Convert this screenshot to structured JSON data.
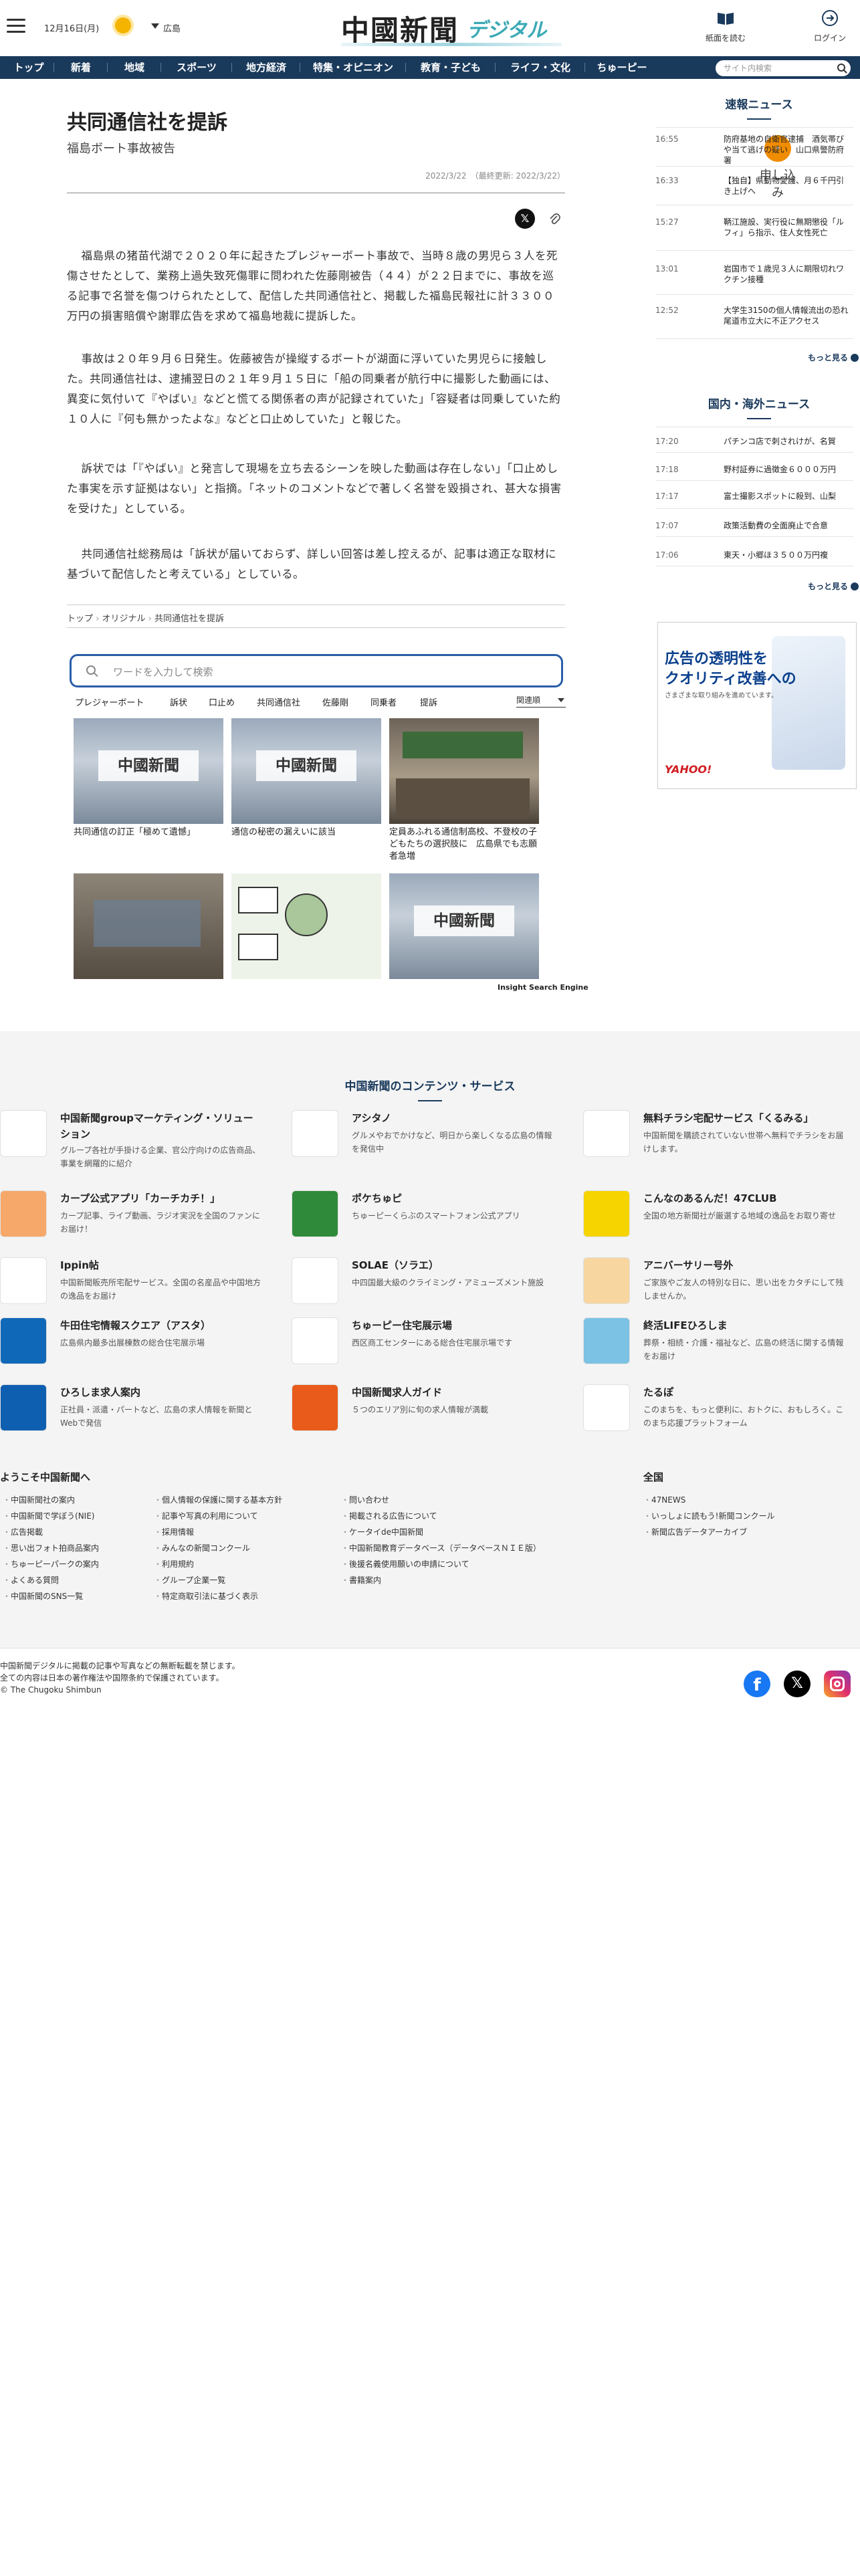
{
  "header": {
    "date": "12月16日(月)",
    "area": "広島",
    "logo_main": "中國新聞",
    "logo_sub": "デジタル",
    "icons": [
      {
        "label": "紙面を読む"
      },
      {
        "label": "申し込み"
      },
      {
        "label": "ログイン"
      }
    ]
  },
  "nav": {
    "items": [
      "トップ",
      "新着",
      "地域",
      "スポーツ",
      "地方経済",
      "特集・オピニオン",
      "教育・子ども",
      "ライフ・文化",
      "ちゅーピー"
    ],
    "search_placeholder": "サイト内検索"
  },
  "article": {
    "title": "共同通信社を提訴",
    "subtitle": "福島ボート事故被告",
    "date": "2022/3/22　（最終更新: 2022/3/22）",
    "paragraphs": [
      "福島県の猪苗代湖で２０２０年に起きたプレジャーボート事故で、当時８歳の男児ら３人を死傷させたとして、業務上過失致死傷罪に問われた佐藤剛被告（４４）が２２日までに、事故を巡る記事で名誉を傷つけられたとして、配信した共同通信社と、掲載した福島民報社に計３３００万円の損害賠償や謝罪広告を求めて福島地裁に提訴した。",
      "事故は２０年９月６日発生。佐藤被告が操縦するボートが湖面に浮いていた男児らに接触した。共同通信社は、逮捕翌日の２１年９月１５日に「船の同乗者が航行中に撮影した動画には、異変に気付いて『やばい』などと慌てる関係者の声が記録されていた」「容疑者は同乗していた約１０人に『何も無かったよな』などと口止めしていた」と報じた。",
      "訴状では「『やばい』と発言して現場を立ち去るシーンを映した動画は存在しない」「口止めした事実を示す証拠はない」と指摘。「ネットのコメントなどで著しく名誉を毀損され、甚大な損害を受けた」としている。",
      "共同通信社総務局は「訴状が届いておらず、詳しい回答は差し控えるが、記事は適正な取材に基づいて配信したと考えている」としている。"
    ],
    "breadcrumb": [
      "トップ",
      "オリジナル",
      "共同通信社を提訴"
    ]
  },
  "search": {
    "placeholder": "ワードを入力して検索",
    "tags": [
      "プレジャーボート",
      "訴状",
      "口止め",
      "共同通信社",
      "佐藤剛",
      "同乗者",
      "提訴"
    ],
    "sort": "関連順"
  },
  "related": [
    {
      "title": "共同通信の訂正「極めて遺憾」",
      "cap": "中國新聞"
    },
    {
      "title": "通信の秘密の漏えいに該当",
      "cap": "中國新聞"
    },
    {
      "title": "定員あふれる通信制高校、不登校の子どもたちの選択肢に　広島県でも志願者急増"
    },
    {
      "title": ""
    },
    {
      "title": ""
    },
    {
      "title": "",
      "cap": "中國新聞"
    }
  ],
  "ise_label": "Insight Search Engine",
  "sidebar": {
    "breaking_title": "速報ニュース",
    "breaking": [
      {
        "time": "16:55",
        "text": "防府基地の自衛官逮捕　酒気帯びや当て逃げの疑い　山口県警防府署"
      },
      {
        "time": "16:33",
        "text": "【独自】県動物愛護、月６千円引き上げへ"
      },
      {
        "time": "15:27",
        "text": "鞆江施設、実行役に無期懲役「ルフィ」ら指示、住人女性死亡"
      },
      {
        "time": "13:01",
        "text": "岩国市で１歳児３人に期限切れワクチン接種"
      },
      {
        "time": "12:52",
        "text": "大学生3150の個人情報流出の恐れ 尾道市立大に不正アクセス"
      }
    ],
    "more": "もっと見る",
    "world_title": "国内・海外ニュース",
    "world": [
      {
        "time": "17:20",
        "text": "パチンコ店で刺されけが、名賀"
      },
      {
        "time": "17:18",
        "text": "野村証券に過徴金６０００万円"
      },
      {
        "time": "17:17",
        "text": "富士撮影スポットに殺到、山梨"
      },
      {
        "time": "17:07",
        "text": "政策活動費の全面廃止で合意"
      },
      {
        "time": "17:06",
        "text": "東天・小郷ほ３５００万円複"
      }
    ],
    "ad": {
      "l1": "広告の透明性を",
      "l2": "クオリティ改善への",
      "l3": "さまざまな取り組みを進めています。",
      "brand": "YAHOO!"
    }
  },
  "services": {
    "title": "中国新聞のコンテンツ・サービス",
    "items": [
      {
        "name": "中国新聞groupマーケティング・ソリューション",
        "desc": "グループ各社が手掛ける企業、官公庁向けの広告商品、事業を網羅的に紹介",
        "color": "#ffffff"
      },
      {
        "name": "アシタノ",
        "desc": "グルメやおでかけなど、明日から楽しくなる広島の情報を発信中",
        "color": "#ffffff"
      },
      {
        "name": "無料チラシ宅配サービス「くるみる」",
        "desc": "中国新聞を購読されていない世帯へ無料でチラシをお届けします。",
        "color": "#ffffff"
      },
      {
        "name": "カープ公式アプリ「カーチカチ！」",
        "desc": "カープ記事、ライブ動画、ラジオ実況を全国のファンにお届け！",
        "color": "#f6a86a"
      },
      {
        "name": "ポケちゅピ",
        "desc": "ちゅーピーくらぶのスマートフォン公式アプリ",
        "color": "#2f8a3a"
      },
      {
        "name": "こんなのあるんだ！47CLUB",
        "desc": "全国の地方新聞社が厳選する地域の逸品をお取り寄せ",
        "color": "#f5d400"
      },
      {
        "name": "Ippin帖",
        "desc": "中国新聞販売所宅配サービス。全国の名産品や中国地方の逸品をお届け",
        "color": "#ffffff"
      },
      {
        "name": "SOLAE（ソラエ）",
        "desc": "中四国最大級のクライミング・アミューズメント施設",
        "color": "#ffffff"
      },
      {
        "name": "アニバーサリー号外",
        "desc": "ご家族やご友人の特別な日に、思い出をカタチにして残しませんか。",
        "color": "#f7d6a0"
      },
      {
        "name": "牛田住宅情報スクエア（アスタ）",
        "desc": "広島県内最多出展棟数の総合住宅展示場",
        "color": "#1068b8"
      },
      {
        "name": "ちゅーピー住宅展示場",
        "desc": "西区商工センターにある総合住宅展示場です",
        "color": "#ffffff"
      },
      {
        "name": "終活LIFEひろしま",
        "desc": "葬祭・相続・介護・福祉など、広島の終活に関する情報をお届け",
        "color": "#7cc2e4"
      },
      {
        "name": "ひろしま求人案内",
        "desc": "正社員・派遣・パートなど、広島の求人情報を新聞とWebで発信",
        "color": "#0f5fb0"
      },
      {
        "name": "中国新聞求人ガイド",
        "desc": "５つのエリア別に旬の求人情報が満載",
        "color": "#e85b1a"
      },
      {
        "name": "たるぽ",
        "desc": "このまちを、もっと便利に、おトクに、おもしろく。このまち応援プラットフォーム",
        "color": "#ffffff"
      }
    ]
  },
  "footer": {
    "welcome": "ようこそ中国新聞へ",
    "national": "全国",
    "col1": [
      "中国新聞社の案内",
      "中国新聞で学ぼう(NIE)",
      "広告掲載",
      "思い出フォト拍商品案内",
      "ちゅーピーパークの案内",
      "よくある質問",
      "中国新聞のSNS一覧"
    ],
    "col2": [
      "個人情報の保護に関する基本方針",
      "記事や写真の利用について",
      "採用情報",
      "みんなの新聞コンクール",
      "利用規約",
      "グループ企業一覧",
      "特定商取引法に基づく表示"
    ],
    "col3": [
      "問い合わせ",
      "掲載される広告について",
      "ケータイde中国新聞",
      "中国新聞教育データベース（データベースＮＩＥ版）",
      "後援名義使用願いの申請について",
      "書籍案内"
    ],
    "col4": [
      "47NEWS",
      "いっしょに読もう!新聞コンクール",
      "新聞広告データアーカイブ"
    ],
    "copyright": [
      "中国新聞デジタルに掲載の記事や写真などの無断転載を禁じます。",
      "全ての内容は日本の著作権法や国際条約で保護されています。",
      "© The Chugoku Shimbun"
    ]
  }
}
